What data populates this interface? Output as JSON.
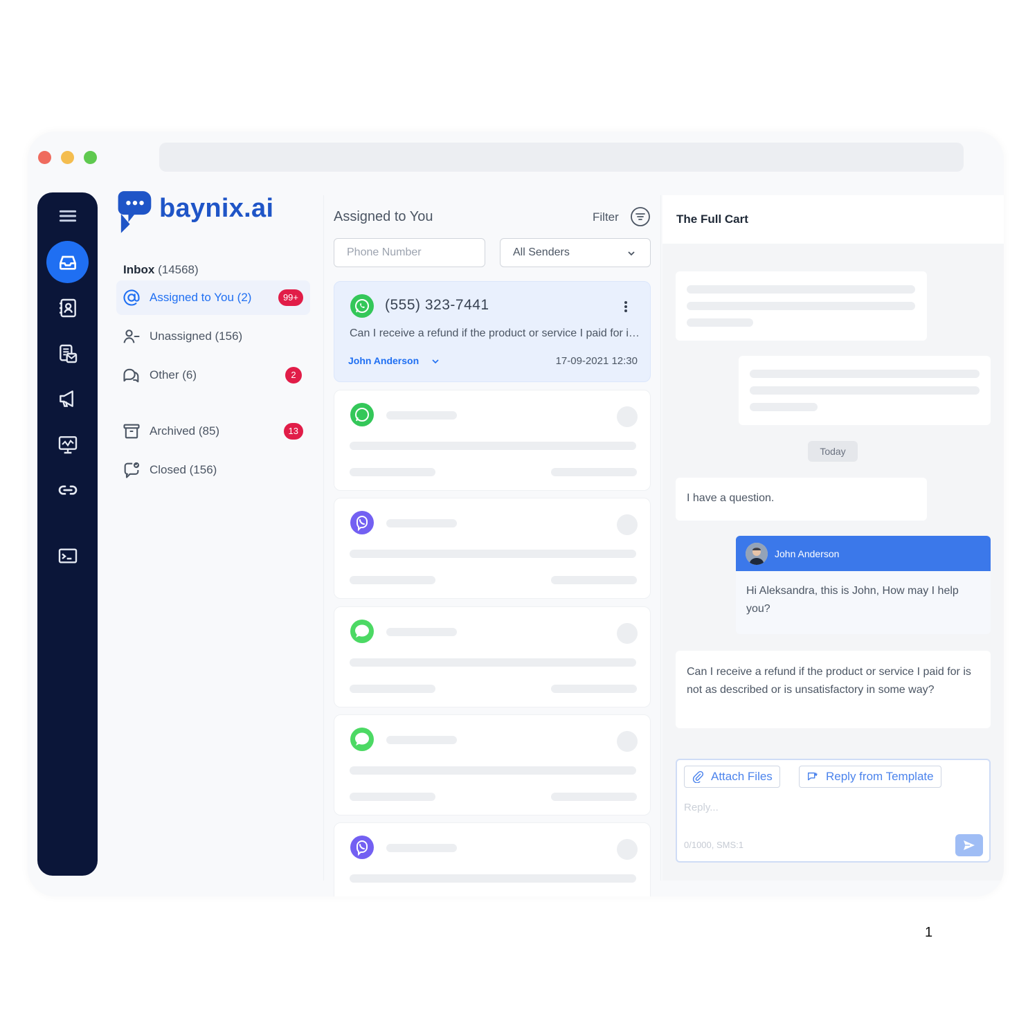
{
  "brand": {
    "name": "baynix.ai",
    "color": "#1f55c7"
  },
  "colors": {
    "rail": "#0b1639",
    "accent": "#1f6ff2",
    "badge": "#e11d48"
  },
  "rail_icons": [
    "menu-icon",
    "inbox-icon",
    "contacts-icon",
    "templates-icon",
    "campaign-icon",
    "analytics-icon",
    "integrations-icon",
    "terminal-icon"
  ],
  "inbox": {
    "label": "Inbox",
    "count": "(14568)",
    "items": [
      {
        "label": "Assigned to You (2)",
        "badge": "99+",
        "icon": "at-sign-icon"
      },
      {
        "label": "Unassigned (156)",
        "badge": "",
        "icon": "user-minus-icon"
      },
      {
        "label": "Other (6)",
        "badge": "2",
        "icon": "chat-bubbles-icon"
      },
      {
        "label": "Archived (85)",
        "badge": "13",
        "icon": "archive-icon"
      },
      {
        "label": "Closed (156)",
        "badge": "",
        "icon": "chat-closed-icon"
      }
    ]
  },
  "conversations": {
    "title": "Assigned to You",
    "filter_label": "Filter",
    "phone_placeholder": "Phone Number",
    "sender_select": "All Senders",
    "selected": {
      "phone": "(555) 323-7441",
      "preview": "Can I receive a refund if the product or service I paid for is not as described or is unsatisfactory in some way?",
      "agent": "John Anderson",
      "date": "17-09-2021 12:30",
      "channel": "whatsapp-icon"
    },
    "placeholder_channels": [
      "whatsapp-icon",
      "viber-icon",
      "imessage-icon",
      "imessage-icon",
      "viber-icon"
    ]
  },
  "chat": {
    "title": "The Full Cart",
    "date_divider": "Today",
    "incoming_1": "I have a question.",
    "agent_name": "John Anderson",
    "agent_message": "Hi Aleksandra, this is John, How may I help you?",
    "incoming_2": "Can I receive a refund if the product or service I paid for is not as described or is unsatisfactory in some way?",
    "attach_label": "Attach Files",
    "template_label": "Reply from Template",
    "reply_placeholder": "Reply...",
    "counter": "0/1000, SMS:1"
  },
  "page_number": "1"
}
